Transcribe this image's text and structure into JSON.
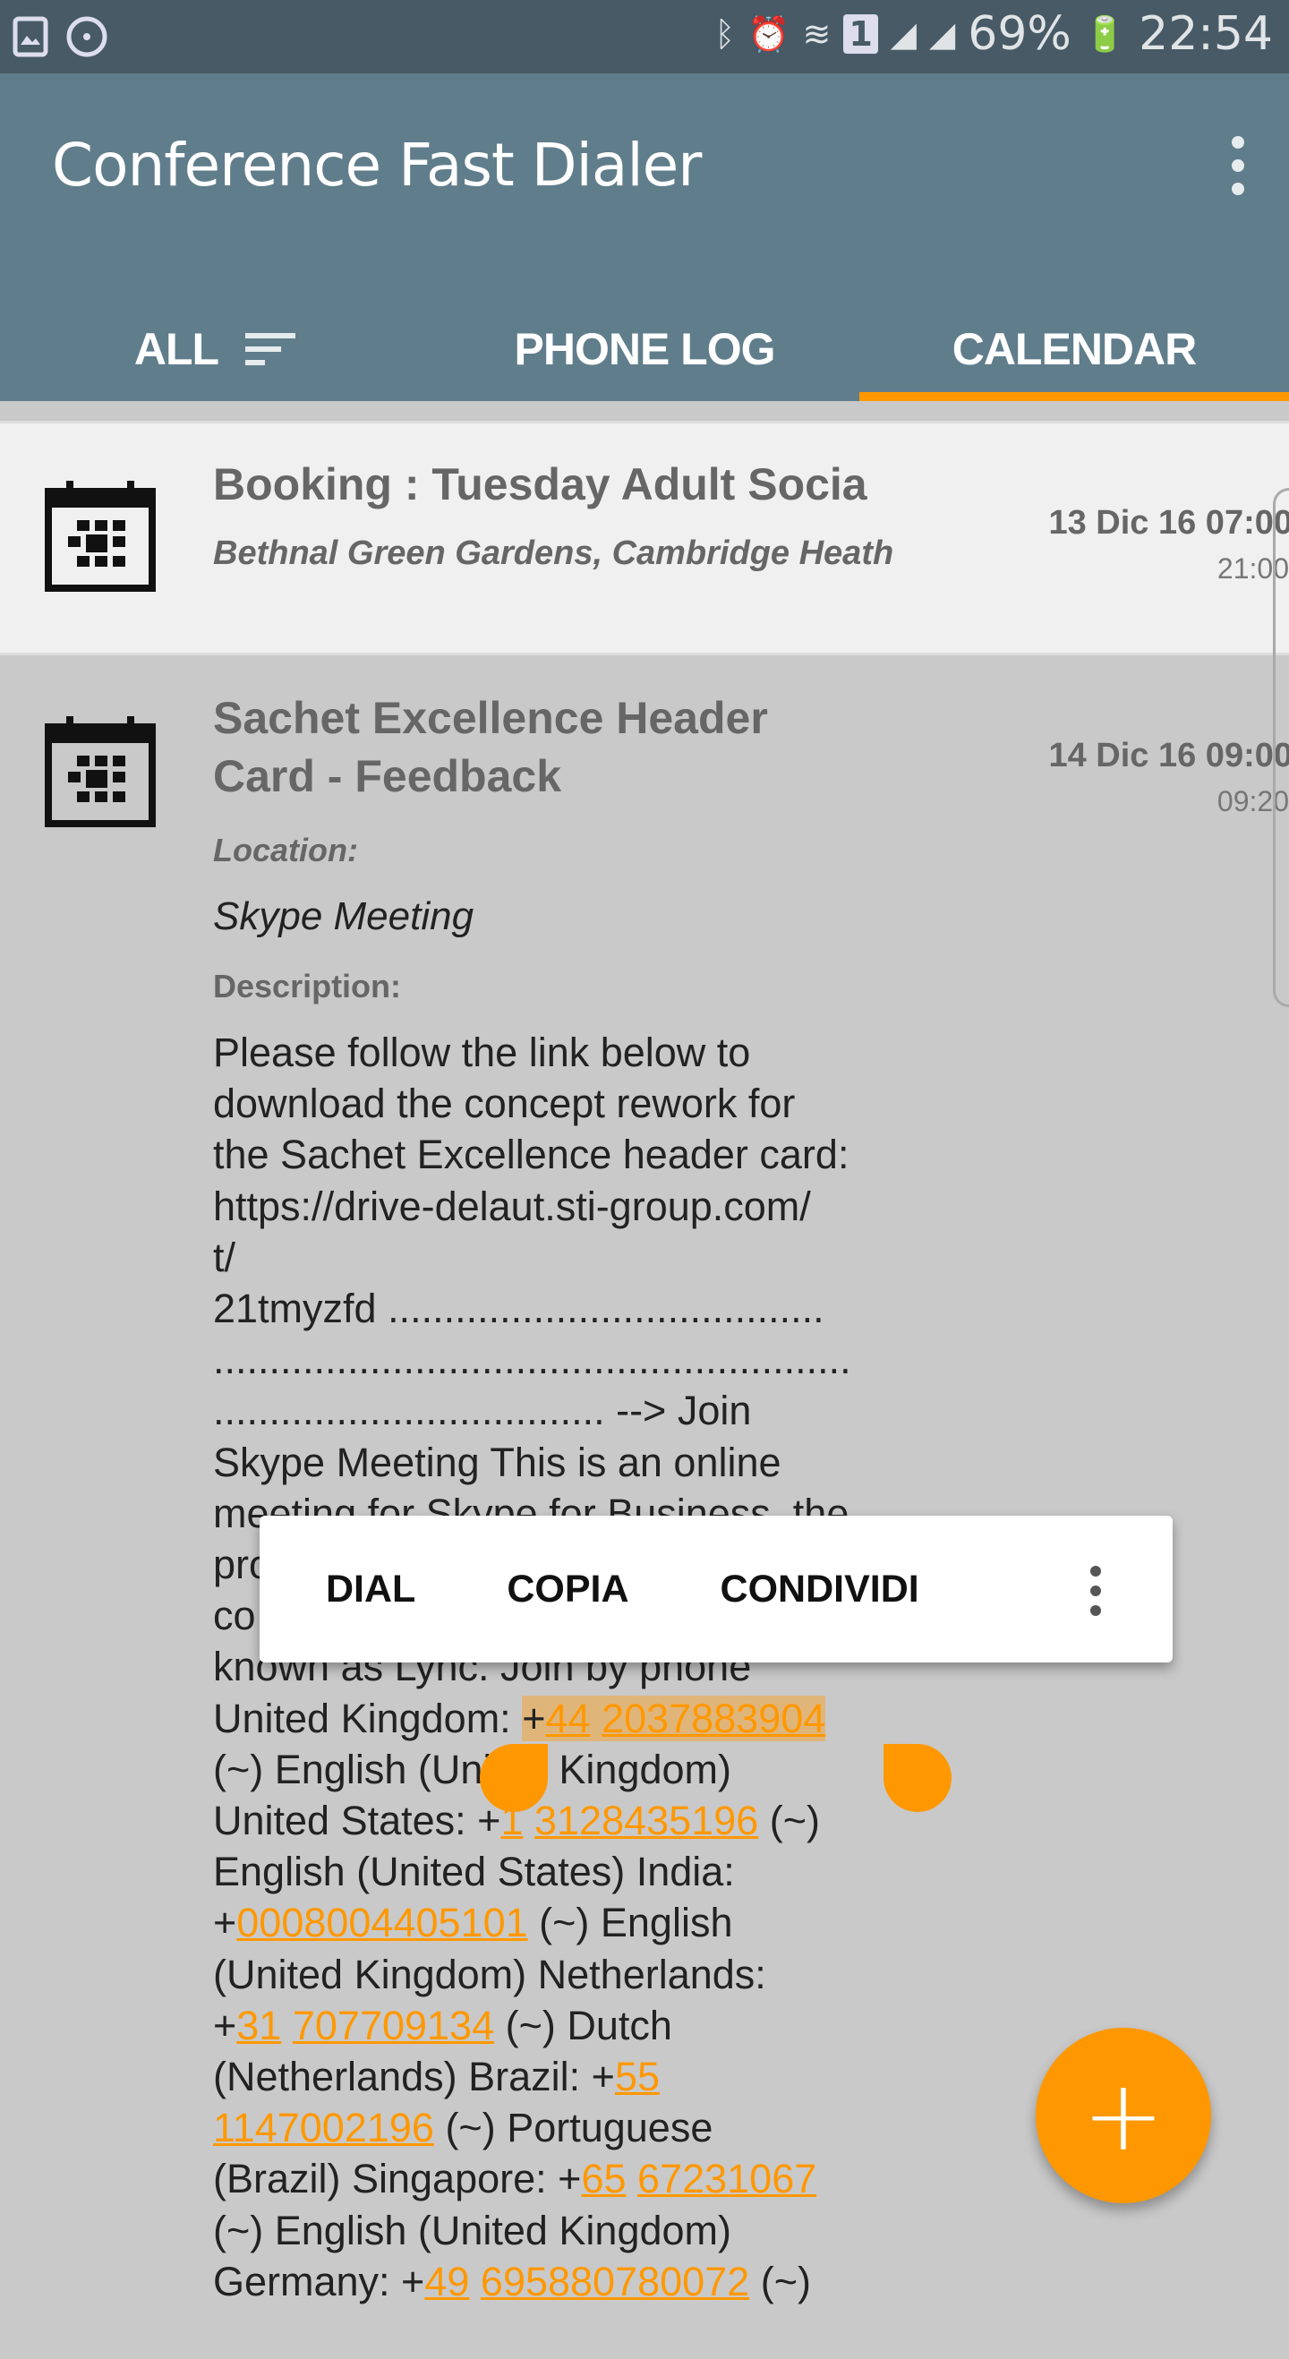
{
  "status_bar": {
    "battery": "69%",
    "time": "22:54",
    "icons": [
      "image-icon",
      "sync-icon",
      "bluetooth-icon",
      "alarm-icon",
      "wifi-icon",
      "sim-1-icon",
      "signal-icon",
      "roaming-signal-icon",
      "battery-charging-icon"
    ]
  },
  "app_bar": {
    "title": "Conference Fast Dialer",
    "menu_icon": "more-vert-icon"
  },
  "tabs": [
    {
      "label": "ALL",
      "icon": "sort-icon"
    },
    {
      "label": "PHONE LOG"
    },
    {
      "label": "CALENDAR",
      "active": true
    }
  ],
  "accent": "#ff9800",
  "primary": "#607d8b",
  "events": [
    {
      "title": "Booking : Tuesday Adult Socia",
      "subtitle": "Bethnal Green Gardens, Cambridge Heath",
      "date": "13 Dic 16 07:00",
      "end": "21:00"
    },
    {
      "title_lines": [
        "Sachet Excellence Header",
        "Card - Feedback"
      ],
      "date": "14 Dic 16 09:00",
      "end": "09:20",
      "location_label": "Location:",
      "location": "Skype Meeting",
      "description_label": "Description:",
      "description_lines": [
        [
          {
            "t": "Please follow the link below to"
          }
        ],
        [
          {
            "t": "download the concept rework for"
          }
        ],
        [
          {
            "t": "the Sachet Excellence header card:"
          }
        ],
        [
          {
            "t": "https://drive-delaut.sti-group.com/"
          }
        ],
        [
          {
            "t": "t/"
          }
        ],
        [
          {
            "t": "21tmyzfd ......................................."
          }
        ],
        [
          {
            "t": "........................................................."
          }
        ],
        [
          {
            "t": "................................... --> Join"
          }
        ],
        [
          {
            "t": "Skype Meeting This is an online"
          }
        ],
        [
          {
            "t": "meeting for Skype for Business, the"
          }
        ],
        [
          {
            "t": "pro"
          }
        ],
        [
          {
            "t": "co"
          }
        ],
        [
          {
            "t": "known as Lync. Join by phone"
          }
        ],
        [
          {
            "t": "United Kingdom: "
          },
          {
            "t": "+",
            "sel": true
          },
          {
            "t": "44",
            "link": true,
            "sel": true
          },
          {
            "t": " ",
            "sel": true
          },
          {
            "t": "2037883904",
            "link": true,
            "sel": true
          }
        ],
        [
          {
            "t": "(~) English (United Kingdom)"
          }
        ],
        [
          {
            "t": "United States: +"
          },
          {
            "t": "1",
            "link": true
          },
          {
            "t": " "
          },
          {
            "t": "3128435196",
            "link": true
          },
          {
            "t": " (~)"
          }
        ],
        [
          {
            "t": "English (United States) India:"
          }
        ],
        [
          {
            "t": "+"
          },
          {
            "t": "0008004405101",
            "link": true
          },
          {
            "t": " (~) English"
          }
        ],
        [
          {
            "t": "(United Kingdom) Netherlands:"
          }
        ],
        [
          {
            "t": "+"
          },
          {
            "t": "31",
            "link": true
          },
          {
            "t": " "
          },
          {
            "t": "707709134",
            "link": true
          },
          {
            "t": " (~) Dutch"
          }
        ],
        [
          {
            "t": "(Netherlands) Brazil: +"
          },
          {
            "t": "55",
            "link": true
          }
        ],
        [
          {
            "t": "1147002196",
            "link": true
          },
          {
            "t": " (~) Portuguese"
          }
        ],
        [
          {
            "t": "(Brazil) Singapore: +"
          },
          {
            "t": "65",
            "link": true
          },
          {
            "t": " "
          },
          {
            "t": "67231067",
            "link": true
          }
        ],
        [
          {
            "t": "(~) English (United Kingdom)"
          }
        ],
        [
          {
            "t": "Germany: +"
          },
          {
            "t": "49",
            "link": true
          },
          {
            "t": " "
          },
          {
            "t": "695880780072",
            "link": true
          },
          {
            "t": " (~)"
          }
        ]
      ]
    }
  ],
  "selection_menu": {
    "items": [
      "DIAL",
      "COPIA",
      "CONDIVIDI"
    ],
    "more_icon": "more-vert-icon"
  },
  "fab": {
    "label": "+",
    "icon": "add-icon"
  }
}
